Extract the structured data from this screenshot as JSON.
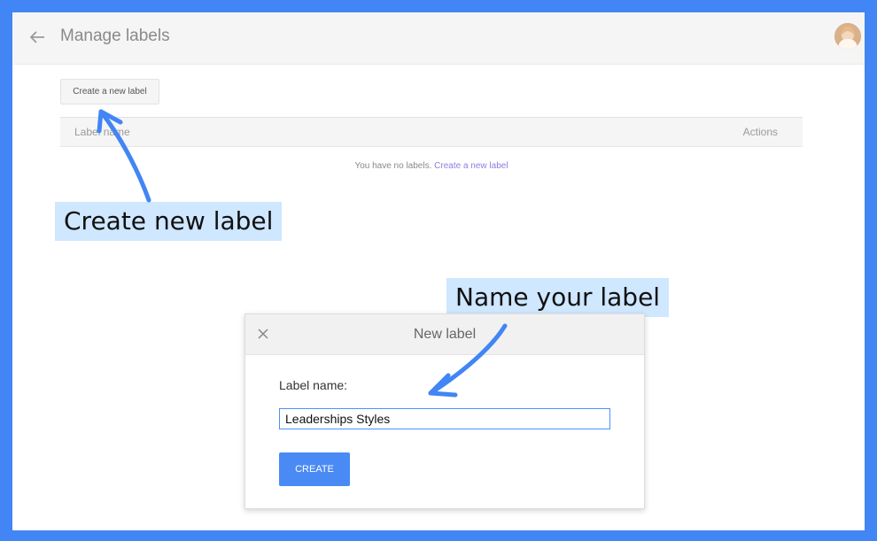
{
  "header": {
    "title": "Manage labels",
    "back_icon": "arrow-left-icon",
    "avatar_icon": "user-avatar"
  },
  "toolbar": {
    "create_label": "Create a new label"
  },
  "table": {
    "columns": [
      "Label name",
      "Actions"
    ],
    "empty_text": "You have no labels.",
    "empty_link": "Create a new label"
  },
  "annotations": {
    "create_label": "Create new label",
    "name_label": "Name your label",
    "arrow_color": "#4285f4"
  },
  "dialog": {
    "title": "New label",
    "close_icon": "close-icon",
    "field_label": "Label name:",
    "field_value": "Leaderships Styles",
    "create_button": "CREATE"
  },
  "colors": {
    "frame": "#4285f4",
    "primary_button": "#4a8af4",
    "callout_bg": "#cfe7ff",
    "link": "#8a7fe0"
  }
}
